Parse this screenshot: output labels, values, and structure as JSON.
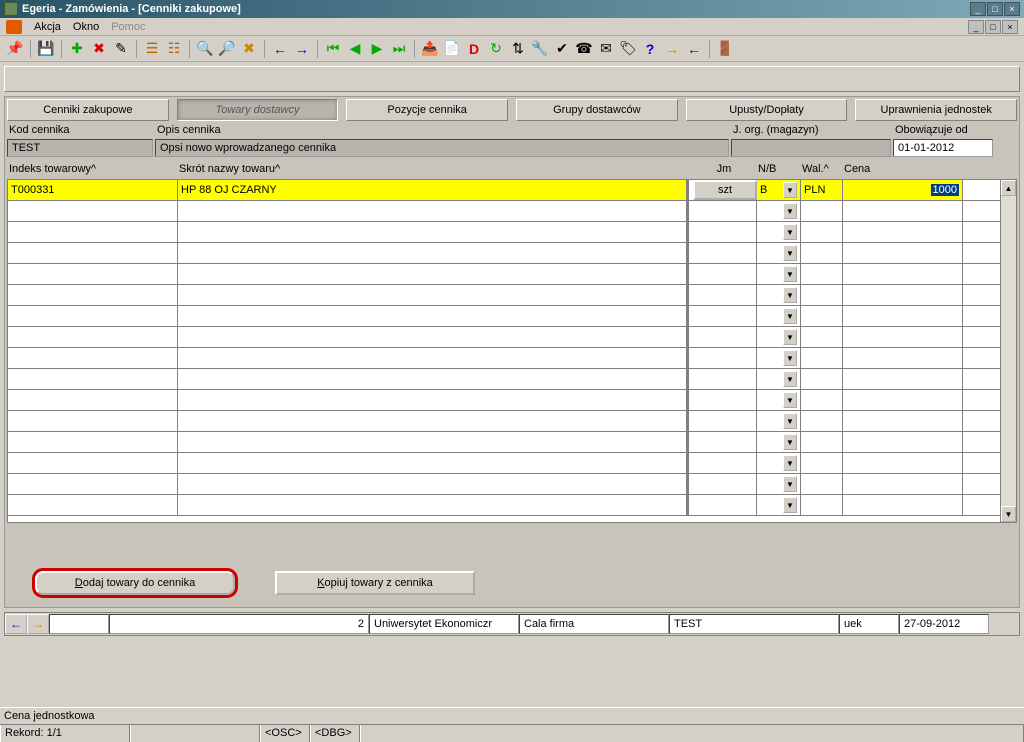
{
  "titlebar": {
    "title": "Egeria - Zamówienia - [Cenniki zakupowe]"
  },
  "menu": {
    "items": [
      "Akcja",
      "Okno"
    ],
    "dim": "Pomoc"
  },
  "tabs": [
    {
      "label": "Cenniki zakupowe",
      "active": false
    },
    {
      "label": "Towary dostawcy",
      "active": true
    },
    {
      "label": "Pozycje cennika",
      "active": false
    },
    {
      "label": "Grupy dostawców",
      "active": false
    },
    {
      "label": "Upusty/Dopłaty",
      "active": false
    },
    {
      "label": "Uprawnienia jednostek",
      "active": false
    }
  ],
  "header": {
    "kod_label": "Kod cennika",
    "kod_value": "TEST",
    "opis_label": "Opis cennika",
    "opis_value": "Opsi nowo wprowadzanego cennika",
    "jorg_label": "J. org. (magazyn)",
    "jorg_value": "",
    "obow_label": "Obowiązuje od",
    "obow_value": "01-01-2012"
  },
  "grid": {
    "cols": {
      "indeks": "Indeks towarowy^",
      "skrot": "Skrót nazwy towaru^",
      "jm": "Jm",
      "nb": "N/B",
      "wal": "Wal.^",
      "cena": "Cena"
    },
    "row1": {
      "indeks": "T000331",
      "skrot": "HP 88 OJ CZARNY",
      "jm": "szt",
      "nb": "B",
      "wal": "PLN",
      "cena": "1000"
    }
  },
  "buttons": {
    "dodaj": "Dodaj towary do cennika",
    "kopiuj": "Kopiuj towary z cennika"
  },
  "bottomnav": {
    "num": "2",
    "org": "Uniwersytet Ekonomiczr",
    "firma": "Cala firma",
    "test": "TEST",
    "user": "uek",
    "date": "27-09-2012"
  },
  "status": {
    "label": "Cena jednostkowa",
    "rekord": "Rekord: 1/1",
    "osc": "<OSC>",
    "dbg": "<DBG>"
  }
}
